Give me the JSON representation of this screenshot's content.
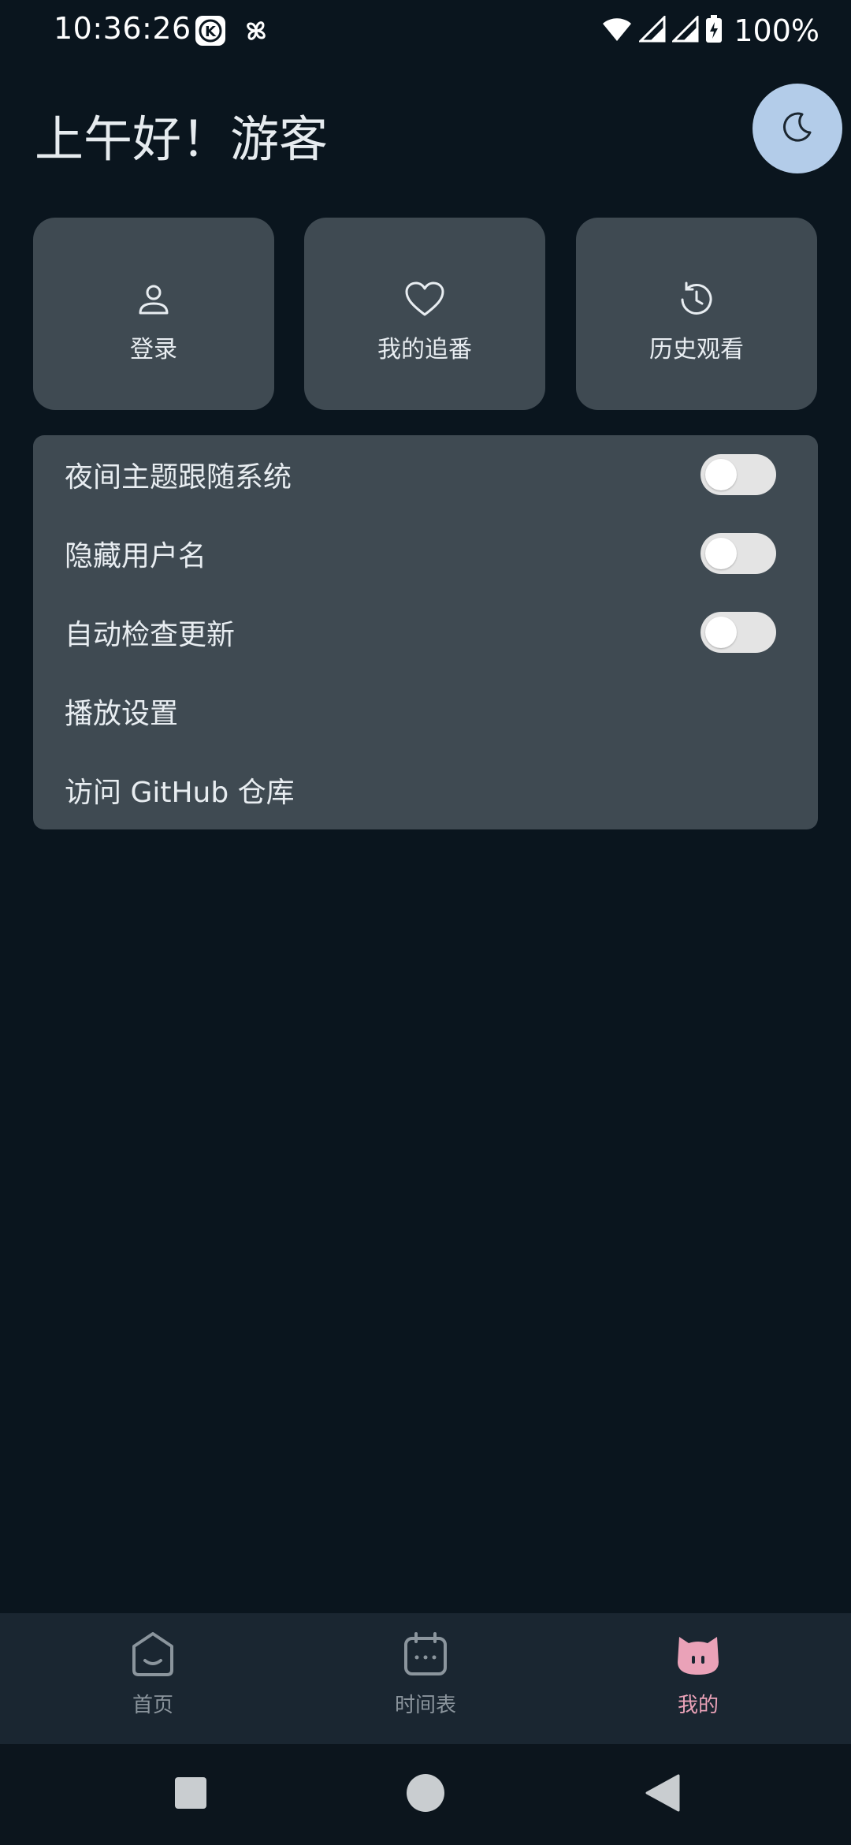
{
  "status_bar": {
    "time": "10:36:26",
    "battery": "100%",
    "icons": [
      "keyboard-app-icon",
      "pinwheel-icon",
      "wifi-icon",
      "signal-icon",
      "signal-icon",
      "battery-charging-icon"
    ]
  },
  "header": {
    "greeting": "上午好！游客",
    "theme_icon": "moon-icon"
  },
  "quick_actions": [
    {
      "label": "登录",
      "icon": "user-icon"
    },
    {
      "label": "我的追番",
      "icon": "heart-icon"
    },
    {
      "label": "历史观看",
      "icon": "history-icon"
    }
  ],
  "settings": {
    "items": [
      {
        "label": "夜间主题跟随系统",
        "toggle": false
      },
      {
        "label": "隐藏用户名",
        "toggle": false
      },
      {
        "label": "自动检查更新",
        "toggle": false
      },
      {
        "label": "播放设置"
      },
      {
        "label": "访问 GitHub 仓库"
      }
    ]
  },
  "bottom_nav": {
    "items": [
      {
        "label": "首页",
        "icon": "home-icon",
        "active": false
      },
      {
        "label": "时间表",
        "icon": "calendar-icon",
        "active": false
      },
      {
        "label": "我的",
        "icon": "cat-icon",
        "active": true
      }
    ]
  },
  "system_nav": [
    "recents-square-icon",
    "home-circle-icon",
    "back-triangle-icon"
  ],
  "colors": {
    "background": "#0a151e",
    "card": "#3f4a52",
    "accent_button": "#b3cce9",
    "nav_active": "#eaa2b8",
    "nav_inactive": "#8b959d"
  }
}
